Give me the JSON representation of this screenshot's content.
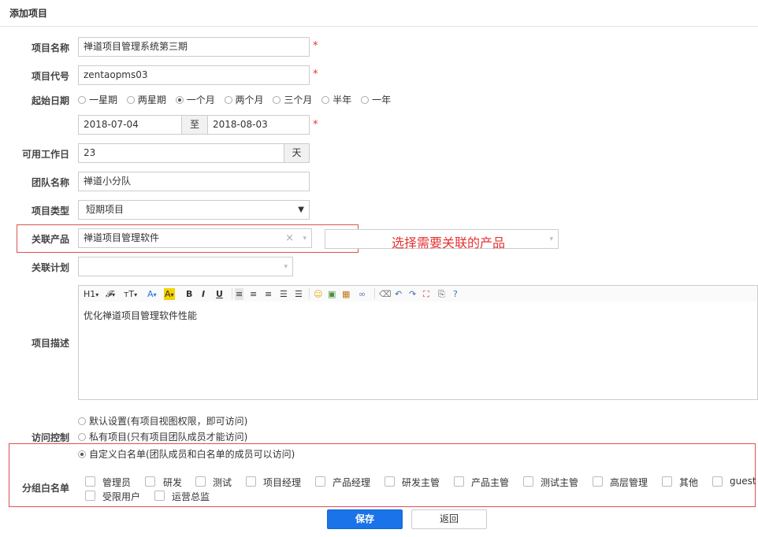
{
  "page": {
    "title": "添加项目"
  },
  "form": {
    "name": {
      "label": "项目名称",
      "value": "禅道项目管理系统第三期",
      "required": "*"
    },
    "code": {
      "label": "项目代号",
      "value": "zentaopms03",
      "required": "*"
    },
    "period": {
      "label": "起始日期",
      "options": [
        "一星期",
        "两星期",
        "一个月",
        "两个月",
        "三个月",
        "半年",
        "一年"
      ],
      "selected": "一个月",
      "begin": "2018-07-04",
      "to": "至",
      "end": "2018-08-03",
      "required": "*"
    },
    "days": {
      "label": "可用工作日",
      "value": "23",
      "unit": "天"
    },
    "team": {
      "label": "团队名称",
      "value": "禅道小分队"
    },
    "type": {
      "label": "项目类型",
      "value": "短期项目"
    },
    "products": {
      "label": "关联产品",
      "value": "禅道项目管理软件",
      "clear": "×",
      "hint": "选择需要关联的产品"
    },
    "plans": {
      "label": "关联计划",
      "value": ""
    },
    "desc": {
      "label": "项目描述",
      "toolbar": [
        "H1",
        "𝓕",
        "тT",
        "A",
        "A",
        "B",
        "I",
        "U"
      ],
      "value": "优化禅道项目管理软件性能"
    },
    "acl": {
      "label": "访问控制",
      "options": [
        "默认设置(有项目视图权限，即可访问)",
        "私有项目(只有项目团队成员才能访问)",
        "自定义白名单(团队成员和白名单的成员可以访问)"
      ],
      "selected": "自定义白名单(团队成员和白名单的成员可以访问)"
    },
    "whitelist": {
      "label": "分组白名单",
      "groups": [
        "管理员",
        "研发",
        "测试",
        "项目经理",
        "产品经理",
        "研发主管",
        "产品主管",
        "测试主管",
        "高层管理",
        "其他",
        "guest",
        "受限用户",
        "运营总监"
      ]
    }
  },
  "actions": {
    "save": "保存",
    "back": "返回"
  },
  "colors": {
    "primary": "#1a73e8",
    "required": "#e53333",
    "highlight_border": "#d9534f"
  }
}
